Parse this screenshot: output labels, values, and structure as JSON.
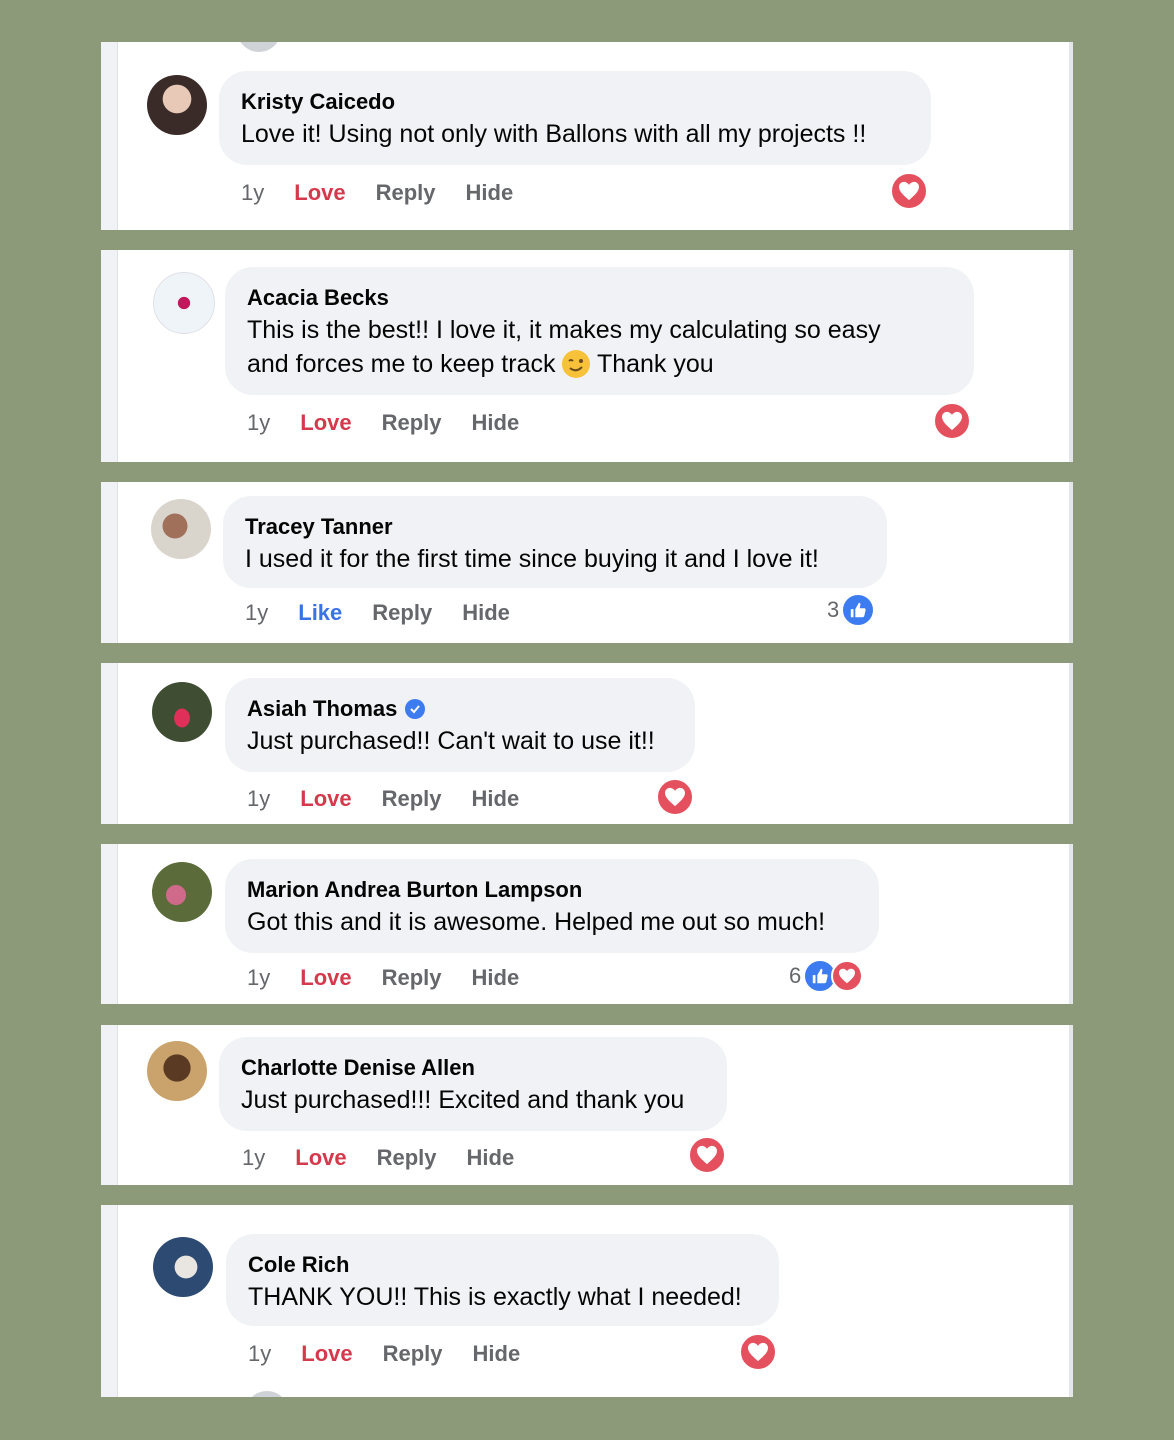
{
  "comments": [
    {
      "author": "Kristy Caicedo",
      "text": "Love it! Using not only with Ballons with all my projects !!",
      "time": "1y",
      "reaction_label": "Love",
      "reply": "Reply",
      "hide": "Hide",
      "reaction_count": ""
    },
    {
      "author": "Acacia Becks",
      "text_line1": "This is the best!! I love it, it makes my calculating so easy",
      "text_line2a": "and forces me to keep track",
      "text_line2b": "Thank you",
      "time": "1y",
      "reaction_label": "Love",
      "reply": "Reply",
      "hide": "Hide",
      "reaction_count": ""
    },
    {
      "author": "Tracey Tanner",
      "text": "I used it for the first time since buying it and I love it!",
      "time": "1y",
      "reaction_label": "Like",
      "reply": "Reply",
      "hide": "Hide",
      "reaction_count": "3"
    },
    {
      "author": "Asiah Thomas",
      "text": "Just purchased!! Can't wait to use it!!",
      "time": "1y",
      "reaction_label": "Love",
      "reply": "Reply",
      "hide": "Hide",
      "reaction_count": ""
    },
    {
      "author": "Marion Andrea Burton Lampson",
      "text": "Got this and it is awesome. Helped me out so much!",
      "time": "1y",
      "reaction_label": "Love",
      "reply": "Reply",
      "hide": "Hide",
      "reaction_count": "6"
    },
    {
      "author": "Charlotte Denise Allen",
      "text": "Just purchased!!! Excited and thank you",
      "time": "1y",
      "reaction_label": "Love",
      "reply": "Reply",
      "hide": "Hide",
      "reaction_count": ""
    },
    {
      "author": "Cole Rich",
      "text": "THANK YOU!! This is exactly what I needed!",
      "time": "1y",
      "reaction_label": "Love",
      "reply": "Reply",
      "hide": "Hide",
      "reaction_count": ""
    }
  ],
  "colors": {
    "background": "#8c9a7a",
    "bubble": "#f0f2f5",
    "love": "#d43a4c",
    "like": "#3a73e8",
    "muted": "#65676b"
  },
  "icons": [
    "heart-reaction-icon",
    "like-reaction-icon",
    "verified-badge-icon",
    "wink-emoji-icon"
  ]
}
